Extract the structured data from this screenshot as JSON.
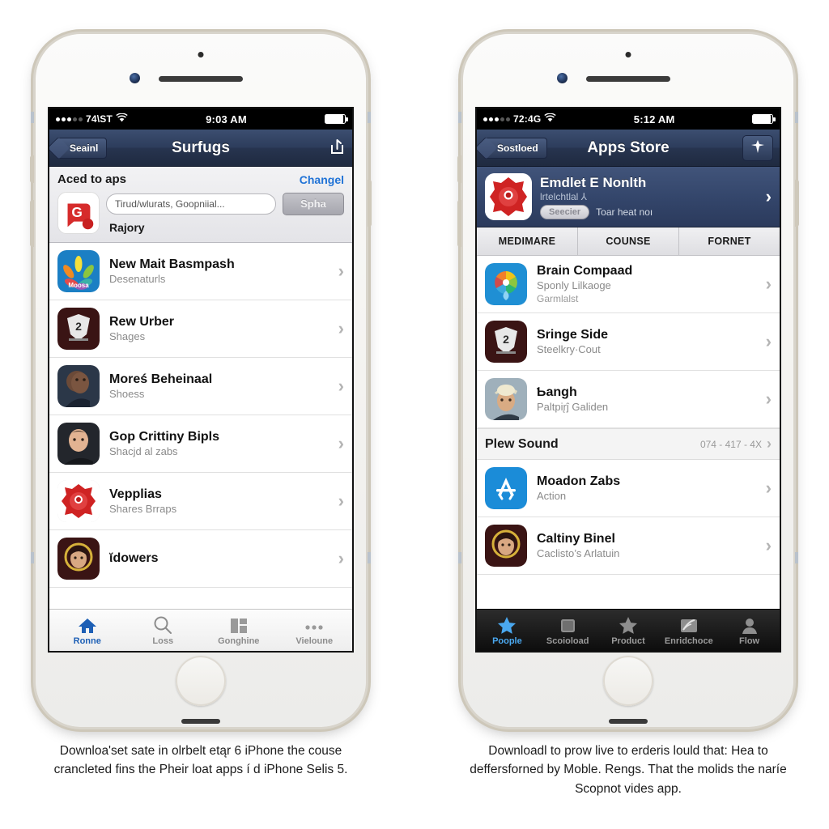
{
  "page": {
    "background": "#ffffff"
  },
  "phones": [
    {
      "id": "left-phone",
      "status_bar": {
        "carrier": "74\\ST",
        "signal_dots": [
          true,
          true,
          true,
          false,
          false
        ],
        "wifi_icon": "wifi-icon",
        "time": "9:03 AM",
        "battery_icon": "battery-icon"
      },
      "navbar": {
        "back_label": "Seainl",
        "title": "Surfugs",
        "action_icon": "share-arrow-icon"
      },
      "compose": {
        "title": "Aced to aps",
        "link_label": "Changel",
        "app_icon": "red-g-app-icon",
        "input_value": "Tirud/wlurats, Goopniial...",
        "input_placeholder": "Tirud/wlurats, Goopniial...",
        "send_label": "Spha",
        "subtitle": "Rajory"
      },
      "list": [
        {
          "icon": "rainbow-peacock-icon",
          "icon_caption": "Moosa",
          "title": "New Mait Basmpash",
          "subtitle": "Desenaturls",
          "chevron": "›"
        },
        {
          "icon": "dark-shield-trophy-icon",
          "icon_caption": "",
          "title": "Rew Urber",
          "subtitle": "Shages",
          "chevron": "›"
        },
        {
          "icon": "man-portrait-icon",
          "icon_caption": "",
          "title": "Moreś Beheinaal",
          "subtitle": "Shoess",
          "chevron": "›"
        },
        {
          "icon": "young-man-portrait-icon",
          "icon_caption": "",
          "title": "Gop Crittiny Bipls",
          "subtitle": "Shacjd al zabs",
          "chevron": "›"
        },
        {
          "icon": "red-emblem-icon",
          "icon_caption": "",
          "title": "Vepplias",
          "subtitle": "Shares Brraps",
          "chevron": "›"
        },
        {
          "icon": "woman-halo-portrait-icon",
          "icon_caption": "",
          "title": "ῐdowers",
          "subtitle": "",
          "chevron": "›"
        }
      ],
      "tabbar": [
        {
          "icon": "home-icon",
          "label": "Ronne",
          "active": true
        },
        {
          "icon": "search-icon",
          "label": "Loss",
          "active": false
        },
        {
          "icon": "grid-icon",
          "label": "Gonghine",
          "active": false
        },
        {
          "icon": "more-dots-icon",
          "label": "Vieloune",
          "active": false
        }
      ],
      "caption": "Downloa'set sate in olrbelt etąr 6 iPhone the couse crancleted fins the Pheir loat apps í d iPhone Selis 5."
    },
    {
      "id": "right-phone",
      "status_bar": {
        "carrier": "72:4G",
        "signal_dots": [
          true,
          true,
          true,
          false,
          false
        ],
        "wifi_icon": "wifi-icon",
        "time": "5:12 AM",
        "battery_icon": "battery-icon"
      },
      "navbar": {
        "back_label": "Sostloed",
        "title": "Apps Store",
        "action_icon": "plus-badge-icon"
      },
      "banner": {
        "icon": "red-emblem-icon",
        "title": "Emdlet E Nonlth",
        "subtitle": "lrtelchtlal ⅄",
        "pill_label": "Seecier",
        "meta": "Toar heat noı",
        "chevron": "›"
      },
      "segments": [
        "MEDIMARE",
        "COUNSE",
        "FORNET"
      ],
      "list": [
        {
          "type": "row",
          "icon": "color-wheel-icon",
          "title": "Brain Compaad",
          "subtitle": "Sponly Lilkaoge",
          "subtitle2": "Garmlalst",
          "chevron": "›"
        },
        {
          "type": "row",
          "icon": "dark-shield-trophy-icon",
          "title": "Sringe Side",
          "subtitle": "Steelkry·Cout",
          "subtitle2": "",
          "chevron": "›"
        },
        {
          "type": "row",
          "icon": "cap-man-portrait-icon",
          "title": "Ƅangh",
          "subtitle": "Paltpir̨ĵ Galiden",
          "subtitle2": "",
          "chevron": "›"
        },
        {
          "type": "section",
          "label": "Plew Sound",
          "value": "074 - 417 -  4X",
          "chevron": "›"
        },
        {
          "type": "row",
          "icon": "app-store-icon",
          "title": "Moadon Zabs",
          "subtitle": "Action",
          "subtitle2": "",
          "chevron": "›"
        },
        {
          "type": "row",
          "icon": "woman-halo-portrait-icon",
          "title": "Caltiny Binel",
          "subtitle": "Caclisto’s Arlatuin",
          "subtitle2": "",
          "chevron": "›"
        }
      ],
      "tabbar": [
        {
          "icon": "star-icon",
          "label": "Poople",
          "active": true
        },
        {
          "icon": "square-icon",
          "label": "Scoioload",
          "active": false
        },
        {
          "icon": "star-outline-icon",
          "label": "Product",
          "active": false
        },
        {
          "icon": "swirl-card-icon",
          "label": "Enridchoce",
          "active": false
        },
        {
          "icon": "person-icon",
          "label": "Flow",
          "active": false
        }
      ],
      "caption": "Downloadl to prow live to erderis lould that: Hea to deffersforned by Moble. Rengs. That the molids the naríe Scopnot vides app."
    }
  ],
  "colors": {
    "navbar": "#2d3d5c",
    "accent_blue": "#1f72d6",
    "tab_active_light": "#1d5fb5",
    "tab_active_dark": "#4aa8ef",
    "muted_text": "#8a8a8a"
  }
}
